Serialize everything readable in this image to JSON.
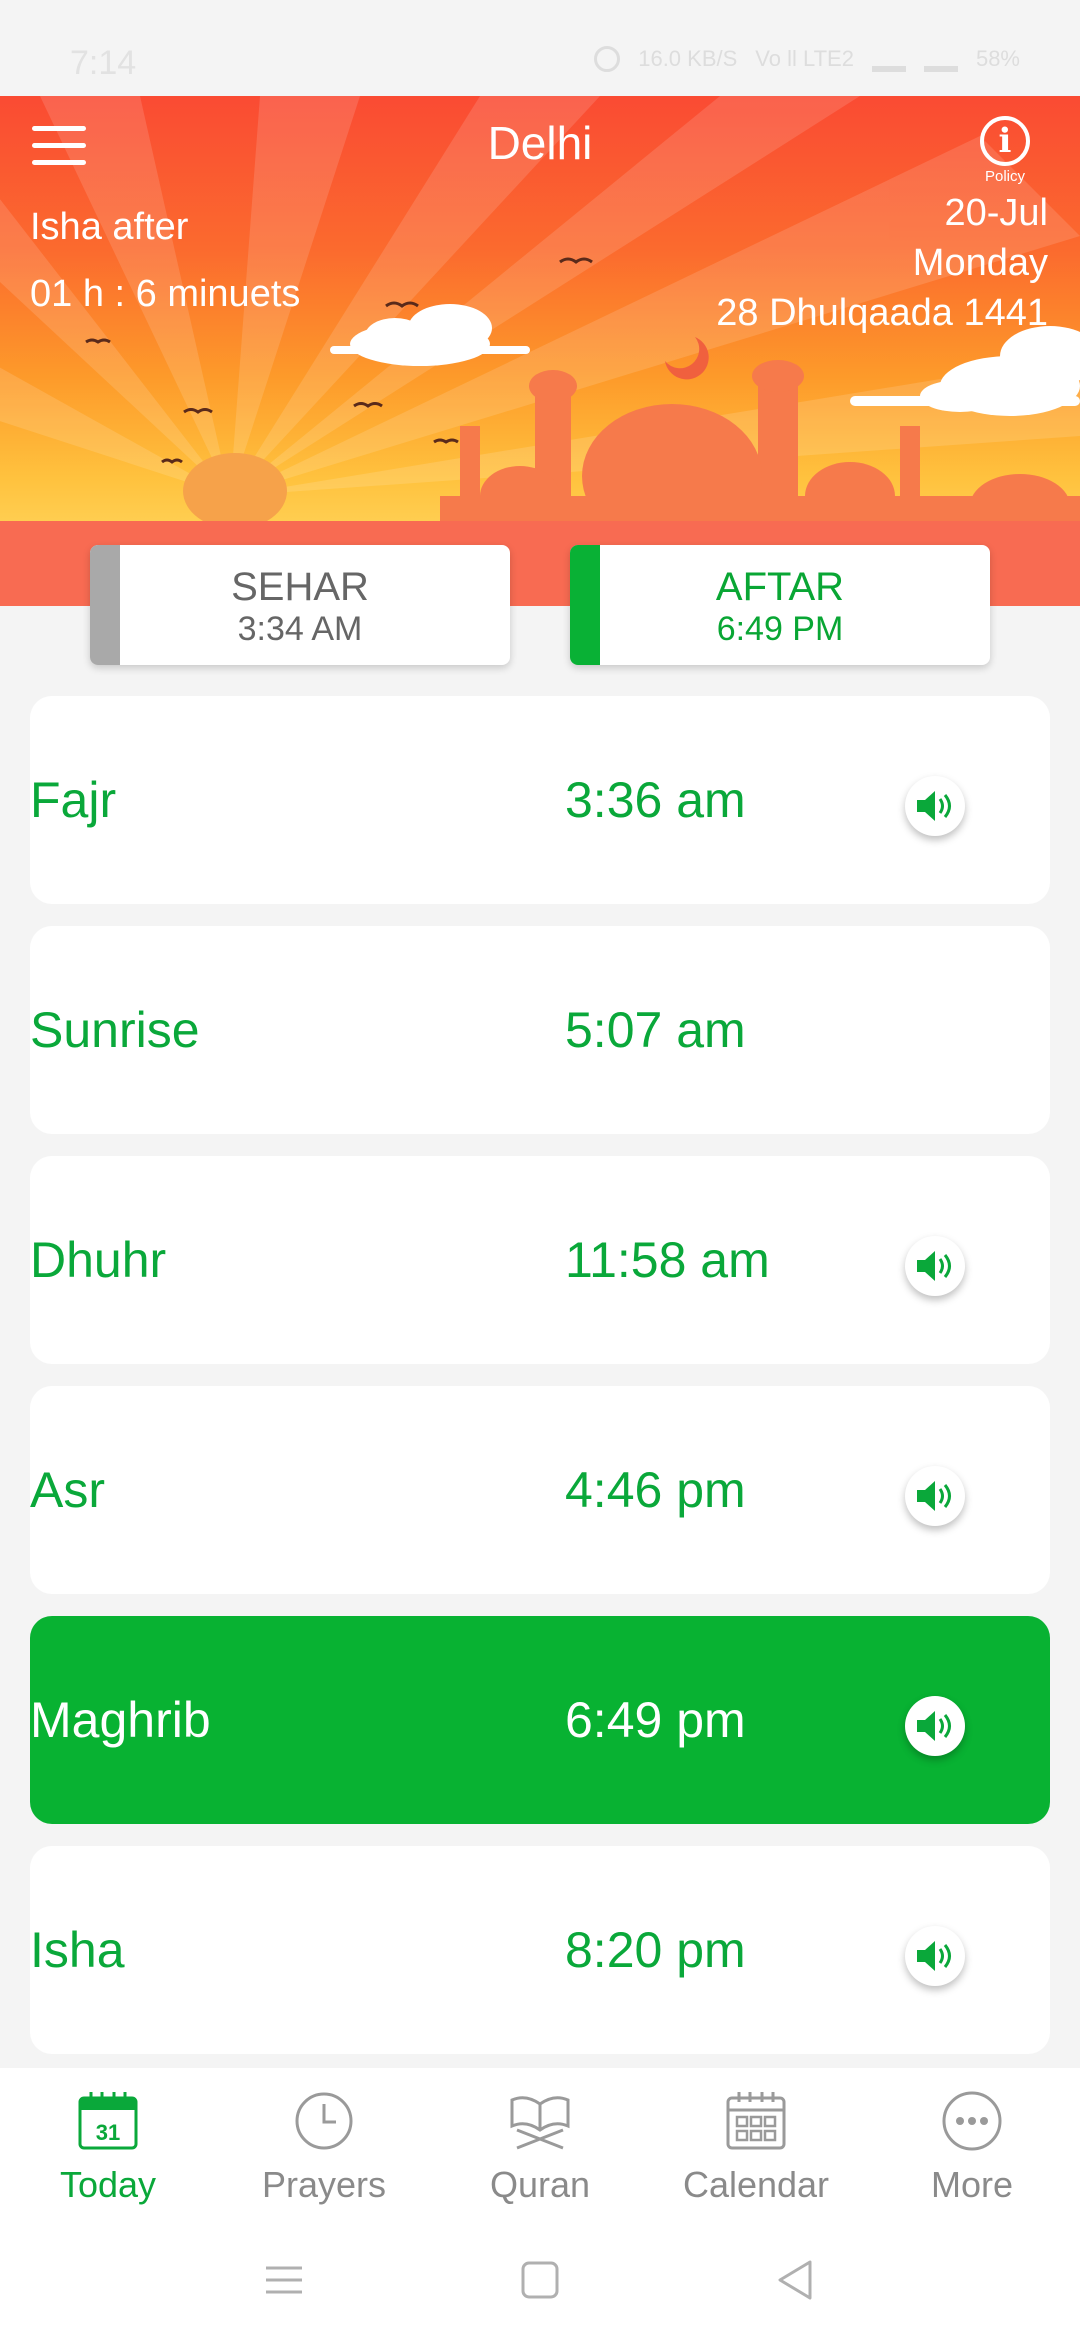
{
  "status_bar": {
    "time": "7:14",
    "speed": "16.0 KB/S",
    "network": "Vo ll LTE2",
    "battery": "58%"
  },
  "header": {
    "city": "Delhi",
    "policy_label": "Policy",
    "countdown_label": "Isha after",
    "countdown_value": "01 h : 6 minuets",
    "gregorian_date": "20-Jul",
    "weekday": "Monday",
    "hijri_date": "28 Dhulqaada 1441"
  },
  "sehar": {
    "label": "SEHAR",
    "time": "3:34 AM"
  },
  "aftar": {
    "label": "AFTAR",
    "time": "6:49 PM"
  },
  "prayers": [
    {
      "name": "Fajr",
      "time": "3:36 am",
      "has_sound": true,
      "active": false
    },
    {
      "name": "Sunrise",
      "time": "5:07 am",
      "has_sound": false,
      "active": false
    },
    {
      "name": "Dhuhr",
      "time": "11:58 am",
      "has_sound": true,
      "active": false
    },
    {
      "name": "Asr",
      "time": "4:46 pm",
      "has_sound": true,
      "active": false
    },
    {
      "name": "Maghrib",
      "time": "6:49 pm",
      "has_sound": true,
      "active": true
    },
    {
      "name": "Isha",
      "time": "8:20 pm",
      "has_sound": true,
      "active": false
    }
  ],
  "bottom_nav": [
    {
      "label": "Today",
      "icon": "calendar-day-icon",
      "icon_text": "31",
      "active": true
    },
    {
      "label": "Prayers",
      "icon": "clock-icon",
      "active": false
    },
    {
      "label": "Quran",
      "icon": "quran-book-icon",
      "active": false
    },
    {
      "label": "Calendar",
      "icon": "calendar-grid-icon",
      "active": false
    },
    {
      "label": "More",
      "icon": "more-dots-icon",
      "active": false
    }
  ],
  "colors": {
    "primary_green": "#09b135",
    "header_red": "#fa4b33",
    "header_orange": "#fd9a2a",
    "inactive_gray": "#8a8a8a"
  }
}
